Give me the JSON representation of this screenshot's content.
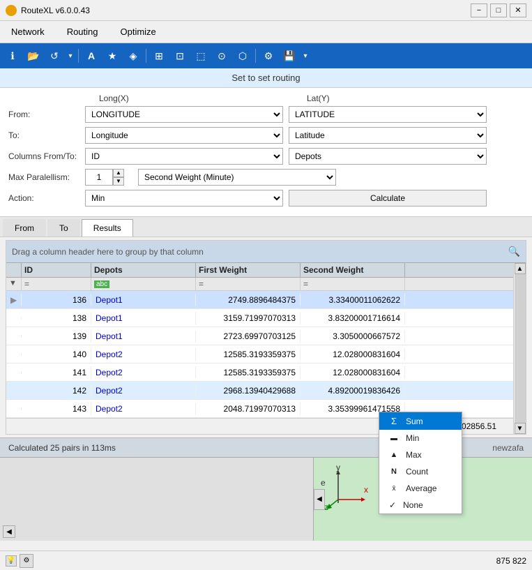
{
  "titleBar": {
    "icon": "route-icon",
    "title": "RouteXL v6.0.0.43",
    "minimize": "−",
    "maximize": "□",
    "close": "✕"
  },
  "menuBar": {
    "items": [
      {
        "label": "Network",
        "active": false
      },
      {
        "label": "Routing",
        "active": false
      },
      {
        "label": "Optimize",
        "active": false
      }
    ]
  },
  "toolbar": {
    "buttons": [
      "ℹ",
      "📁",
      "↺",
      "▾",
      "A",
      "★",
      "⬟",
      "⊞",
      "⊡",
      "⬚",
      "⬛",
      "⊙",
      "⬢",
      "⚙",
      "💾",
      "▾"
    ]
  },
  "sectionHeader": "Set to set routing",
  "form": {
    "colHeaders": {
      "longX": "Long(X)",
      "latY": "Lat(Y)"
    },
    "fromLabel": "From:",
    "fromSelectX": "LONGITUDE",
    "fromSelectY": "LATITUDE",
    "toLabel": "To:",
    "toSelectX": "Longitude",
    "toSelectY": "Latitude",
    "columnsLabel": "Columns From/To:",
    "colSelectX": "ID",
    "colSelectY": "Depots",
    "maxParLabel": "Max Paralellism:",
    "maxParValue": "1",
    "secondWeight": "Second Weight (Minute)",
    "actionLabel": "Action:",
    "actionValue": "Min",
    "calculateBtn": "Calculate"
  },
  "tabs": [
    {
      "label": "From",
      "active": false
    },
    {
      "label": "To",
      "active": false
    },
    {
      "label": "Results",
      "active": true
    }
  ],
  "grid": {
    "groupByText": "Drag a column header here to group by that column",
    "columns": [
      "ID",
      "Depots",
      "First Weight",
      "Second Weight"
    ],
    "filterSymbols": [
      "=",
      "=",
      "=",
      "="
    ],
    "rows": [
      {
        "id": "136",
        "depots": "Depot1",
        "fw": "2749.8896484375",
        "sw": "3.33400011062622",
        "selected": true
      },
      {
        "id": "138",
        "depots": "Depot1",
        "fw": "3159.71997070313",
        "sw": "3.83200001716614"
      },
      {
        "id": "139",
        "depots": "Depot1",
        "fw": "2723.69970703125",
        "sw": "3.3050000667572"
      },
      {
        "id": "140",
        "depots": "Depot2",
        "fw": "12585.3193359375",
        "sw": "12.028000831604"
      },
      {
        "id": "141",
        "depots": "Depot2",
        "fw": "12585.3193359375",
        "sw": "12.028000831604"
      },
      {
        "id": "142",
        "depots": "Depot2",
        "fw": "2968.13940429688",
        "sw": "4.89200019836426",
        "highlight": true
      },
      {
        "id": "143",
        "depots": "Depot2",
        "fw": "2048.71997070313",
        "sw": "3.35399961471558"
      }
    ],
    "sumLabel": "SUM=102856.51"
  },
  "statusBar": {
    "left": "Calculated 25 pairs in 113ms",
    "right": "newzafa"
  },
  "contextMenu": {
    "items": [
      {
        "label": "Sum",
        "active": true,
        "icon": "Σ"
      },
      {
        "label": "Min",
        "active": false,
        "icon": "↓"
      },
      {
        "label": "Max",
        "active": false,
        "icon": "↑"
      },
      {
        "label": "Count",
        "active": false,
        "icon": "N"
      },
      {
        "label": "Average",
        "active": false,
        "icon": "x̄"
      },
      {
        "label": "None",
        "active": false,
        "check": "✓"
      }
    ]
  },
  "bottomBar": {
    "coords": "875  822"
  }
}
